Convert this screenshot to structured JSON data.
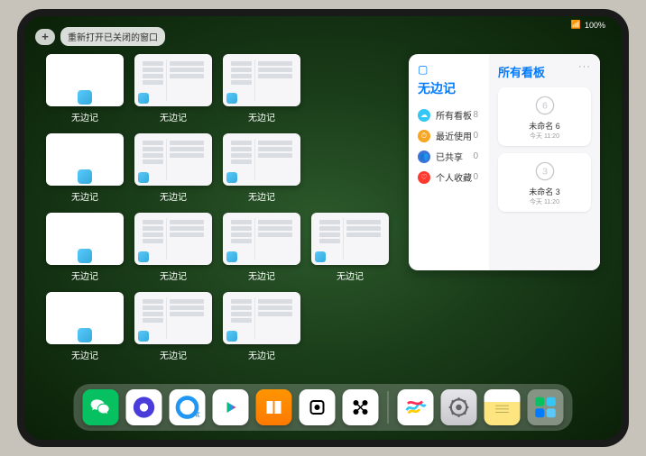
{
  "status": {
    "wifi": "📶",
    "battery": "100%"
  },
  "top": {
    "plus": "+",
    "reopen": "重新打开已关闭的窗口"
  },
  "app_name": "无边记",
  "windows": [
    {
      "type": "blank"
    },
    {
      "type": "detail"
    },
    {
      "type": "detail"
    },
    {
      "type": "blank"
    },
    {
      "type": "detail"
    },
    {
      "type": "detail"
    },
    {
      "type": "blank"
    },
    {
      "type": "detail"
    },
    {
      "type": "detail"
    },
    {
      "type": "detail"
    },
    {
      "type": "blank"
    },
    {
      "type": "detail"
    },
    {
      "type": "detail"
    }
  ],
  "panel": {
    "title": "无边记",
    "menu": [
      {
        "icon_bg": "#34c7f5",
        "glyph": "☁",
        "label": "所有看板",
        "count": 8
      },
      {
        "icon_bg": "#f5a623",
        "glyph": "⏱",
        "label": "最近使用",
        "count": 0
      },
      {
        "icon_bg": "#3b73d9",
        "glyph": "👥",
        "label": "已共享",
        "count": 0
      },
      {
        "icon_bg": "#ff3b30",
        "glyph": "♡",
        "label": "个人收藏",
        "count": 0
      }
    ],
    "right_title": "所有看板",
    "ellipsis": "···",
    "boards": [
      {
        "digit": "6",
        "name": "未命名 6",
        "time": "今天 11:20"
      },
      {
        "digit": "3",
        "name": "未命名 3",
        "time": "今天 11:20"
      }
    ]
  },
  "dock": [
    {
      "id": "wechat",
      "name": "wechat-icon"
    },
    {
      "id": "brave",
      "name": "brave-browser-icon"
    },
    {
      "id": "qbrowser",
      "name": "qq-browser-icon"
    },
    {
      "id": "youku",
      "name": "youku-icon"
    },
    {
      "id": "books",
      "name": "apple-books-icon"
    },
    {
      "id": "obs",
      "name": "dice-app-icon"
    },
    {
      "id": "xmind",
      "name": "xmind-icon"
    },
    {
      "id": "sep"
    },
    {
      "id": "freeform",
      "name": "freeform-icon"
    },
    {
      "id": "settings",
      "name": "settings-icon"
    },
    {
      "id": "notes",
      "name": "notes-icon"
    },
    {
      "id": "folder",
      "name": "app-folder-icon"
    }
  ]
}
